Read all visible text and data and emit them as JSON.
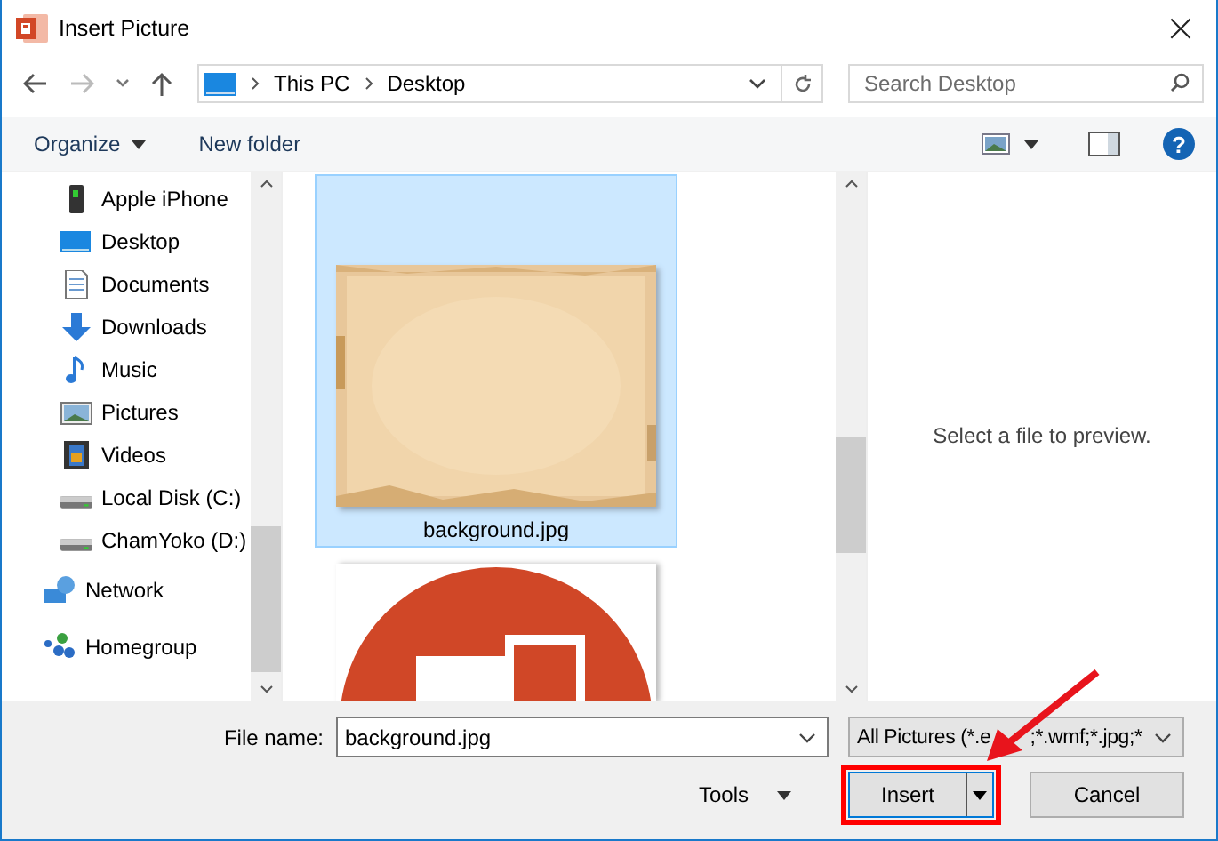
{
  "window": {
    "title": "Insert Picture",
    "close": "×"
  },
  "address": {
    "path": [
      {
        "label": "This PC"
      },
      {
        "label": "Desktop"
      }
    ]
  },
  "search": {
    "placeholder": "Search Desktop"
  },
  "toolbar": {
    "organize": "Organize",
    "new_folder": "New folder",
    "help": "?"
  },
  "sidebar": {
    "items": [
      {
        "label": "Apple iPhone",
        "kind": "phone"
      },
      {
        "label": "Desktop",
        "kind": "desktop"
      },
      {
        "label": "Documents",
        "kind": "documents"
      },
      {
        "label": "Downloads",
        "kind": "downloads"
      },
      {
        "label": "Music",
        "kind": "music"
      },
      {
        "label": "Pictures",
        "kind": "pictures"
      },
      {
        "label": "Videos",
        "kind": "videos"
      },
      {
        "label": "Local Disk (C:)",
        "kind": "disk"
      },
      {
        "label": "ChamYoko (D:)",
        "kind": "disk"
      }
    ],
    "roots": [
      {
        "label": "Network",
        "kind": "network"
      },
      {
        "label": "Homegroup",
        "kind": "homegroup"
      }
    ]
  },
  "files": [
    {
      "name": "background.jpg",
      "selected": true,
      "kind": "picture"
    },
    {
      "selected": false,
      "kind": "picture"
    }
  ],
  "preview": {
    "message": "Select a file to preview."
  },
  "footer": {
    "file_name_label": "File name:",
    "file_name": "background.jpg",
    "filter": "All Pictures (*.e",
    "filter_rest": ";*.wmf;*.jpg;*",
    "tools": "Tools",
    "insert": "Insert",
    "cancel": "Cancel"
  }
}
